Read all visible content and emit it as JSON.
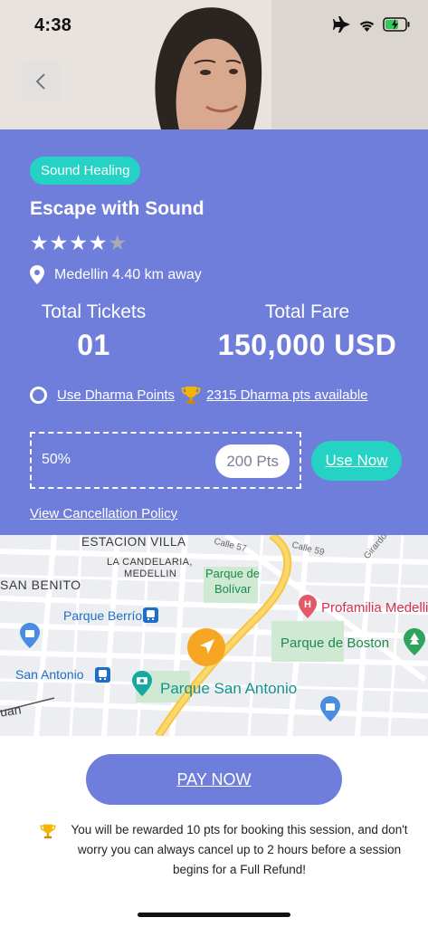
{
  "status": {
    "time": "4:38"
  },
  "event": {
    "category": "Sound Healing",
    "title": "Escape with Sound",
    "rating": 4,
    "rating_max": 5,
    "location": "Medellin 4.40 km away"
  },
  "stats": {
    "tickets_label": "Total Tickets",
    "tickets_value": "01",
    "fare_label": "Total Fare",
    "fare_value": "150,000 USD"
  },
  "points": {
    "use_label": "Use Dharma Points",
    "available_label": "2315 Dharma pts available",
    "percent": "50%",
    "pts_value": "200 Pts",
    "use_now_label": "Use Now"
  },
  "cancellation_label": "View Cancellation Policy",
  "map": {
    "labels": {
      "estacion_villa": "ESTACION VILLA",
      "calle57": "Calle 57",
      "calle59": "Calle 59",
      "girardot": "Girardot",
      "candelaria_1": "LA CANDELARIA,",
      "candelaria_2": "MEDELLIN",
      "parque_bolivar_1": "Parque de",
      "parque_bolivar_2": "Bolívar",
      "san_benito": "SAN BENITO",
      "profamilia": "Profamilia Medelli",
      "parque_berrio": "Parque Berrío",
      "parque_boston": "Parque de Boston",
      "san_antonio": "San Antonio",
      "parque_san_antonio": "Parque San Antonio",
      "juan": "uan"
    }
  },
  "pay_label": "PAY NOW",
  "reward_text": "You will be rewarded 10 pts for booking this session, and don't worry you can always cancel up to 2 hours before a session begins for a Full Refund!",
  "colors": {
    "panel": "#6f7edb",
    "accent_teal": "#24d3c3",
    "pay_button": "#6f7edb"
  }
}
